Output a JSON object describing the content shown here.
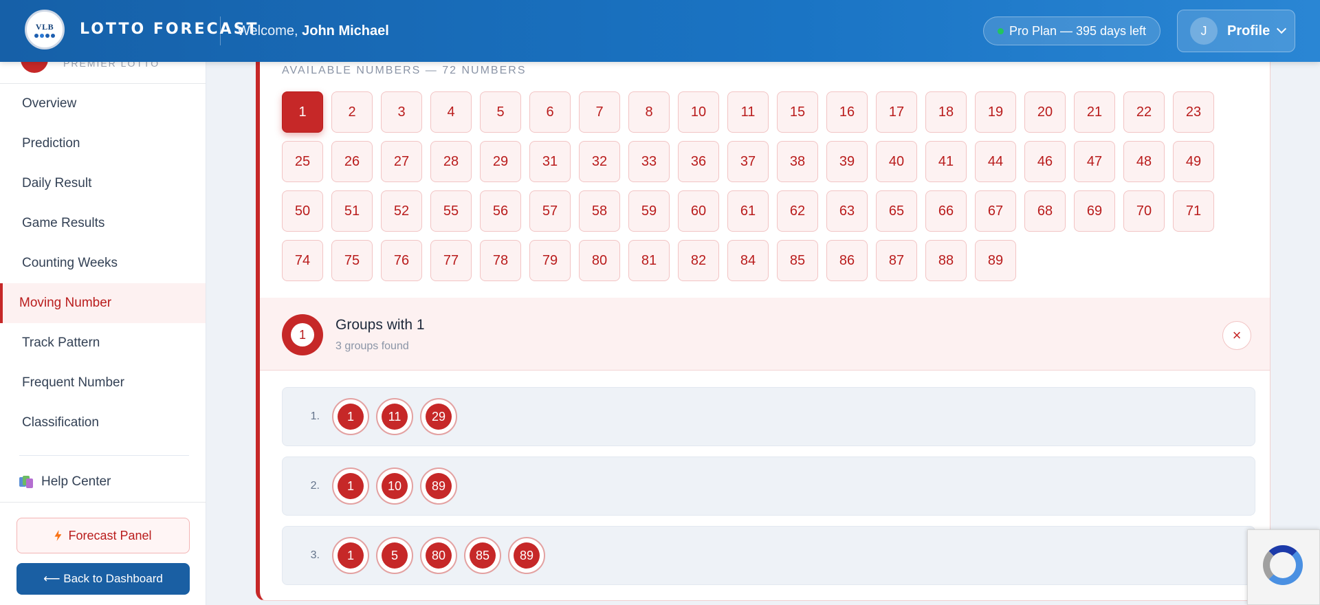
{
  "header": {
    "brand": "LOTTO FORECAST",
    "logo_text": "VLB",
    "welcome_prefix": "Welcome,",
    "user_name": "John Michael",
    "plan": "Pro Plan — 395 days left",
    "avatar_initial": "J",
    "profile_label": "Profile"
  },
  "sidebar": {
    "sub_brand": "PREMIER LOTTO",
    "items": [
      {
        "label": "Overview"
      },
      {
        "label": "Prediction"
      },
      {
        "label": "Daily Result"
      },
      {
        "label": "Game Results"
      },
      {
        "label": "Counting Weeks"
      },
      {
        "label": "Moving Number",
        "active": true
      },
      {
        "label": "Track Pattern"
      },
      {
        "label": "Frequent Number"
      },
      {
        "label": "Classification"
      }
    ],
    "help_label": "Help Center",
    "forecast_label": "Forecast Panel",
    "back_label": "⟵ Back to Dashboard"
  },
  "main": {
    "available_label": "AVAILABLE NUMBERS — 72 NUMBERS",
    "selected": "1",
    "numbers": [
      "1",
      "2",
      "3",
      "4",
      "5",
      "6",
      "7",
      "8",
      "10",
      "11",
      "15",
      "16",
      "17",
      "18",
      "19",
      "20",
      "21",
      "22",
      "23",
      "25",
      "26",
      "27",
      "28",
      "29",
      "31",
      "32",
      "33",
      "36",
      "37",
      "38",
      "39",
      "40",
      "41",
      "44",
      "46",
      "47",
      "48",
      "49",
      "50",
      "51",
      "52",
      "55",
      "56",
      "57",
      "58",
      "59",
      "60",
      "61",
      "62",
      "63",
      "65",
      "66",
      "67",
      "68",
      "69",
      "70",
      "71",
      "74",
      "75",
      "76",
      "77",
      "78",
      "79",
      "80",
      "81",
      "82",
      "84",
      "85",
      "86",
      "87",
      "88",
      "89"
    ],
    "groups_badge": "1",
    "groups_title": "Groups with 1",
    "groups_sub": "3 groups found",
    "close_icon": "×",
    "groups": [
      {
        "index": "1.",
        "numbers": [
          "1",
          "11",
          "29"
        ]
      },
      {
        "index": "2.",
        "numbers": [
          "1",
          "10",
          "89"
        ]
      },
      {
        "index": "3.",
        "numbers": [
          "1",
          "5",
          "80",
          "85",
          "89"
        ]
      }
    ]
  },
  "colors": {
    "header_blue": "#1a74c4",
    "accent_red": "#c62828",
    "back_button": "#1a5fa3"
  }
}
